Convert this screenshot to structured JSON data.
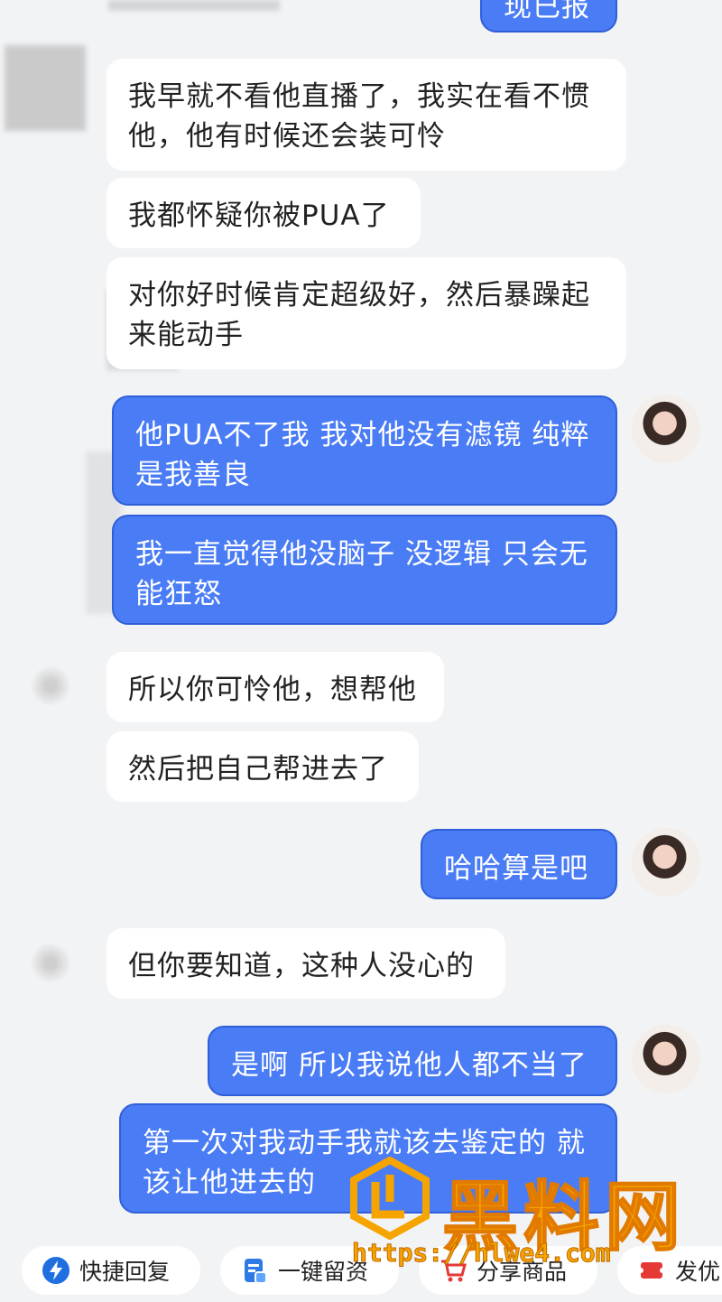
{
  "messages": [
    {
      "side": "out",
      "text": "现已报"
    },
    {
      "side": "in",
      "text": "我早就不看他直播了，我实在看不惯他，他有时候还会装可怜"
    },
    {
      "side": "in",
      "text": "我都怀疑你被PUA了"
    },
    {
      "side": "in",
      "text": "对你好时候肯定超级好，然后暴躁起来能动手"
    },
    {
      "side": "out",
      "text": "他PUA不了我 我对他没有滤镜 纯粹是我善良"
    },
    {
      "side": "out",
      "text": "我一直觉得他没脑子 没逻辑 只会无能狂怒"
    },
    {
      "side": "in",
      "text": "所以你可怜他，想帮他"
    },
    {
      "side": "in",
      "text": "然后把自己帮进去了"
    },
    {
      "side": "out",
      "text": "哈哈算是吧"
    },
    {
      "side": "in",
      "text": "但你要知道，这种人没心的"
    },
    {
      "side": "out",
      "text": "是啊 所以我说他人都不当了"
    },
    {
      "side": "out",
      "text": "第一次对我动手我就该去鉴定的 就该让他进去的"
    }
  ],
  "quick_actions": [
    {
      "label": "快捷回复",
      "icon": "lightning-icon"
    },
    {
      "label": "一键留资",
      "icon": "form-icon"
    },
    {
      "label": "分享商品",
      "icon": "cart-icon"
    },
    {
      "label": "发优",
      "icon": "coupon-icon"
    }
  ],
  "watermark": {
    "logo_text": "黑料网",
    "url": "https://hlwe4.com"
  },
  "colors": {
    "out_bubble": "#4a7cf5",
    "in_bubble": "#ffffff",
    "background": "#f2f3f5",
    "watermark": "#f5a400"
  }
}
